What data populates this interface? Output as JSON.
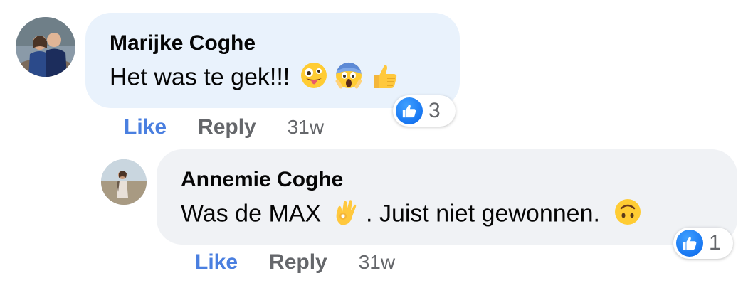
{
  "comments": [
    {
      "author": "Marijke Coghe",
      "text": "Het was te gek!!!",
      "emojis": [
        "zany-face-icon",
        "screaming-face-icon",
        "thumbs-up-icon"
      ],
      "reaction_count": "3",
      "like_label": "Like",
      "reply_label": "Reply",
      "time": "31w"
    },
    {
      "author": "Annemie Coghe",
      "text_before": "Was de MAX",
      "text_after": ". Juist niet gewonnen.",
      "emojis": [
        "ok-hand-icon",
        "upside-down-face-icon"
      ],
      "reaction_count": "1",
      "like_label": "Like",
      "reply_label": "Reply",
      "time": "31w"
    }
  ],
  "colors": {
    "highlight_bubble": "#e9f2fc",
    "reply_bubble": "#f0f2f5",
    "like_blue": "#1877f2",
    "link_like": "#4a7fe0",
    "meta_grey": "#65676b"
  }
}
